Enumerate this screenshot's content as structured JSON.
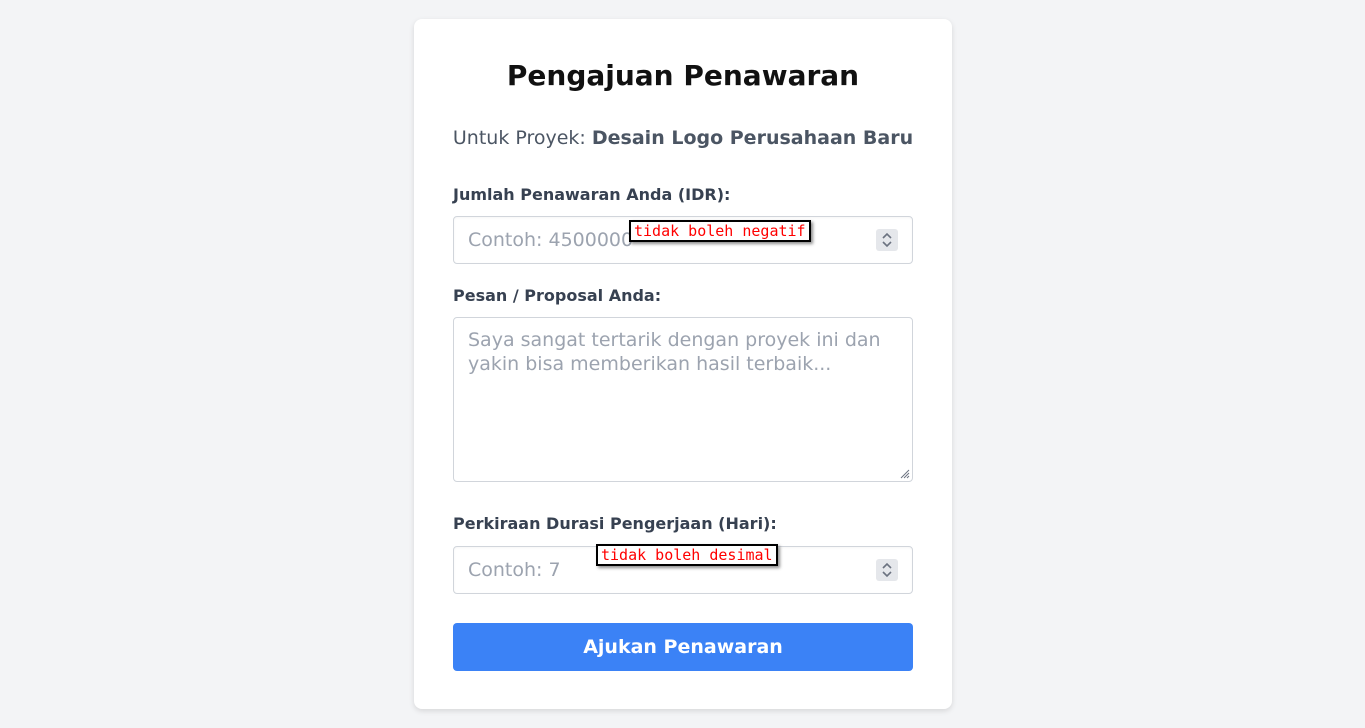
{
  "form": {
    "title": "Pengajuan Penawaran",
    "subtitle_prefix": "Untuk Proyek:",
    "project_name": "Desain Logo Perusahaan Baru",
    "amount": {
      "label": "Jumlah Penawaran Anda (IDR):",
      "placeholder": "Contoh: 4500000",
      "value": "",
      "annotation": "tidak boleh negatif"
    },
    "message": {
      "label": "Pesan / Proposal Anda:",
      "placeholder": "Saya sangat tertarik dengan proyek ini dan yakin bisa memberikan hasil terbaik...",
      "value": ""
    },
    "duration": {
      "label": "Perkiraan Durasi Pengerjaan (Hari):",
      "placeholder": "Contoh: 7",
      "value": "",
      "annotation": "tidak boleh desimal"
    },
    "submit_label": "Ajukan Penawaran"
  },
  "colors": {
    "background": "#f3f4f6",
    "card": "#ffffff",
    "accent": "#3b82f6",
    "annotation_text": "#ff0000"
  },
  "icons": {
    "stepper": "chevron-up-down-icon",
    "resize": "resize-grip-icon"
  }
}
